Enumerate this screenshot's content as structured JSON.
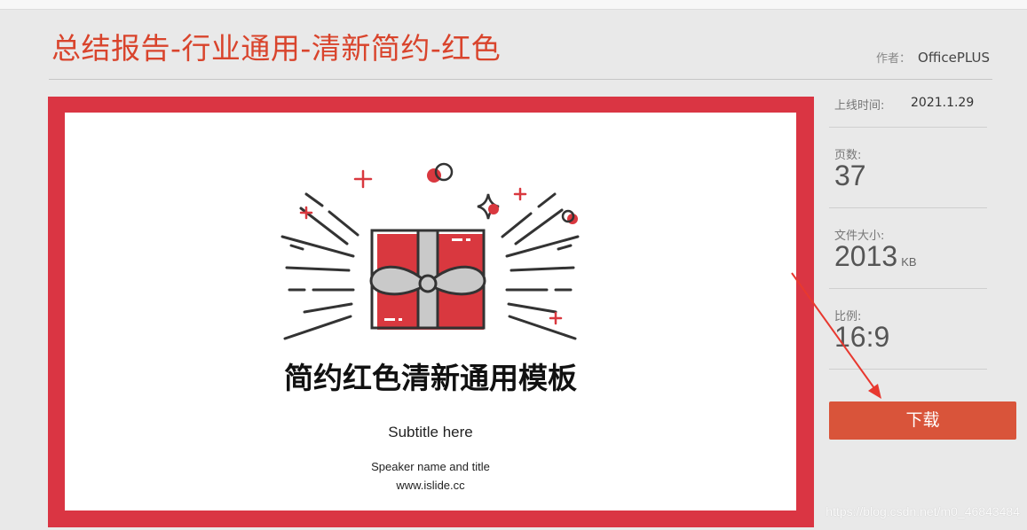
{
  "page": {
    "title": "总结报告-行业通用-清新简约-红色",
    "author_label": "作者：",
    "author": "OfficePLUS"
  },
  "preview": {
    "slide_title": "简约红色清新通用模板",
    "subtitle": "Subtitle here",
    "speaker": "Speaker name and title",
    "url": "www.islide.cc"
  },
  "info": {
    "date_label": "上线时间:",
    "date_value": "2021.1.29",
    "pages_label": "页数:",
    "pages_value": "37",
    "size_label": "文件大小:",
    "size_value": "2013",
    "size_unit": "KB",
    "ratio_label": "比例:",
    "ratio_value": "16:9"
  },
  "actions": {
    "download_label": "下载"
  },
  "watermark": "https://blog.csdn.net/m0_46843484",
  "colors": {
    "accent": "#d9442c",
    "preview_border": "#da3543",
    "button": "#d9543a",
    "annotation_arrow": "#e8382f"
  }
}
